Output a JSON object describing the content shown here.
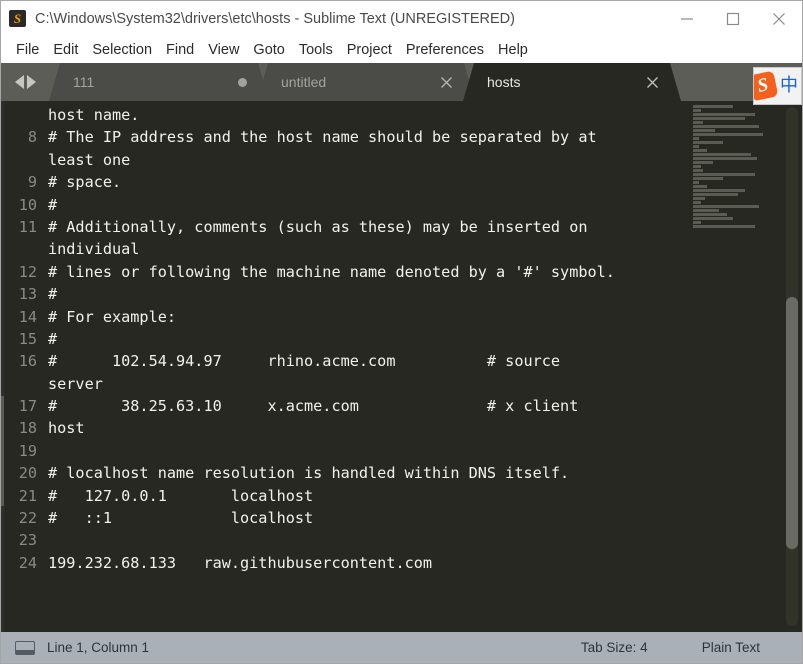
{
  "window": {
    "title": "C:\\Windows\\System32\\drivers\\etc\\hosts - Sublime Text (UNREGISTERED)",
    "app_icon": "sublime-text-icon",
    "app_icon_glyph": "S",
    "controls": {
      "minimize": "minimize-icon",
      "maximize": "maximize-icon",
      "close": "close-icon"
    }
  },
  "menubar": {
    "items": [
      {
        "label": "File"
      },
      {
        "label": "Edit"
      },
      {
        "label": "Selection"
      },
      {
        "label": "Find"
      },
      {
        "label": "View"
      },
      {
        "label": "Goto"
      },
      {
        "label": "Tools"
      },
      {
        "label": "Project"
      },
      {
        "label": "Preferences"
      },
      {
        "label": "Help"
      }
    ]
  },
  "tabbar": {
    "nav_prev_icon": "chevron-left-icon",
    "nav_next_icon": "chevron-right-icon",
    "tabs": [
      {
        "label": "111",
        "active": false,
        "dirty": true,
        "close_glyph": ""
      },
      {
        "label": "untitled",
        "active": false,
        "dirty": false,
        "close_glyph": "×"
      },
      {
        "label": "hosts",
        "active": true,
        "dirty": false,
        "close_glyph": "×"
      }
    ]
  },
  "ime": {
    "name": "sogou-ime-indicator",
    "logo_glyph": "S",
    "mode_glyph": "中",
    "logo_color": "#f4611f",
    "mode_color": "#1565d8"
  },
  "editor": {
    "file": "hosts",
    "colors": {
      "background": "#272822",
      "foreground": "#f2f2ec",
      "gutter": "#8a8b82"
    },
    "lines": [
      {
        "num": "",
        "text": "host name."
      },
      {
        "num": "8",
        "text": "# The IP address and the host name should be separated by at"
      },
      {
        "num": "",
        "text": "least one"
      },
      {
        "num": "9",
        "text": "# space."
      },
      {
        "num": "10",
        "text": "#"
      },
      {
        "num": "11",
        "text": "# Additionally, comments (such as these) may be inserted on"
      },
      {
        "num": "",
        "text": "individual"
      },
      {
        "num": "12",
        "text": "# lines or following the machine name denoted by a '#' symbol."
      },
      {
        "num": "13",
        "text": "#"
      },
      {
        "num": "14",
        "text": "# For example:"
      },
      {
        "num": "15",
        "text": "#"
      },
      {
        "num": "16",
        "text": "#      102.54.94.97     rhino.acme.com          # source"
      },
      {
        "num": "",
        "text": "server"
      },
      {
        "num": "17",
        "text": "#       38.25.63.10     x.acme.com              # x client"
      },
      {
        "num": "18",
        "text": "host"
      },
      {
        "num": "19",
        "text": ""
      },
      {
        "num": "20",
        "text": "# localhost name resolution is handled within DNS itself."
      },
      {
        "num": "21",
        "text": "#   127.0.0.1       localhost"
      },
      {
        "num": "22",
        "text": "#   ::1             localhost"
      },
      {
        "num": "23",
        "text": ""
      },
      {
        "num": "24",
        "text": "199.232.68.133   raw.githubusercontent.com"
      }
    ],
    "minimap": {
      "name": "minimap",
      "row_widths": [
        40,
        8,
        62,
        52,
        10,
        66,
        22,
        70,
        6,
        30,
        6,
        14,
        58,
        64,
        20,
        8,
        10,
        62,
        30,
        6,
        14,
        52,
        45,
        12,
        8,
        66,
        26,
        34,
        40,
        8,
        62
      ]
    },
    "scrollbar": {
      "name": "vertical-scrollbar"
    }
  },
  "statusbar": {
    "icon": "editor-pane-icon",
    "cursor": "Line 1, Column 1",
    "tab_size": "Tab Size: 4",
    "syntax": "Plain Text"
  }
}
